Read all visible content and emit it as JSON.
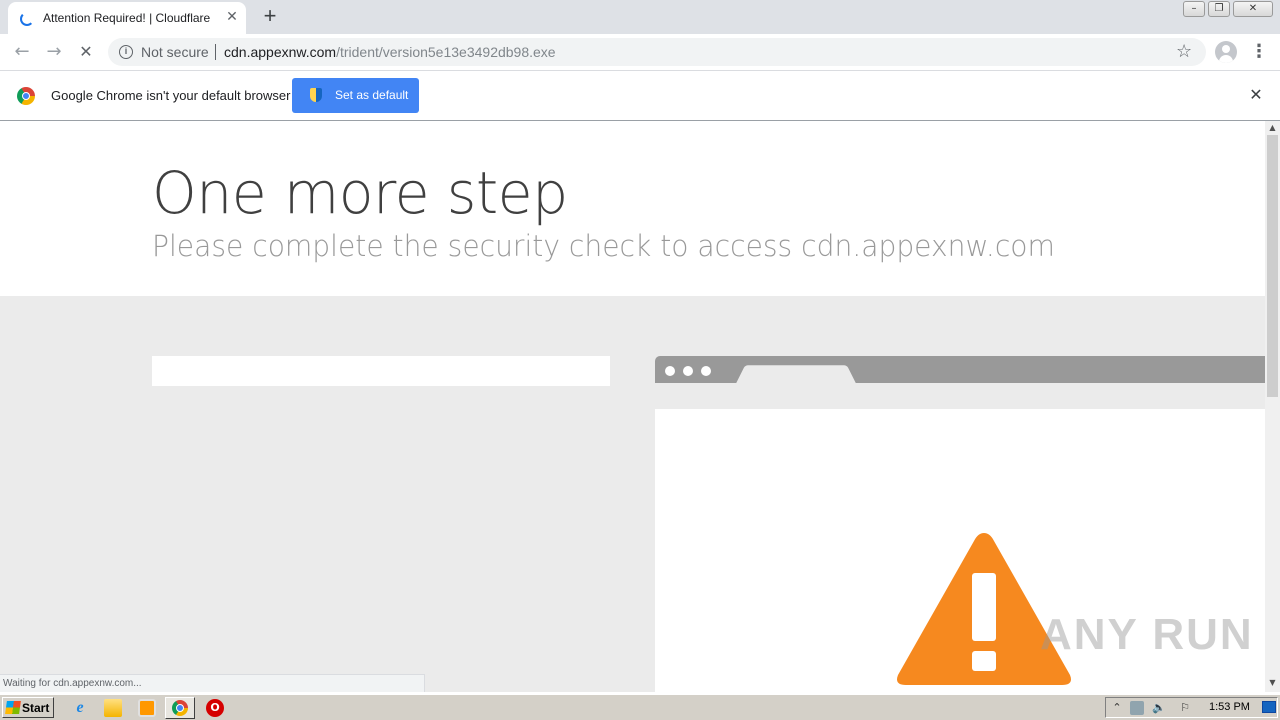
{
  "browser": {
    "tab": {
      "title": "Attention Required! | Cloudflare",
      "close_glyph": "✕"
    },
    "new_tab_glyph": "+",
    "window_controls": {
      "minimize": "–",
      "maximize": "❐",
      "close": "✕"
    },
    "toolbar": {
      "back_glyph": "←",
      "forward_glyph": "→",
      "stop_glyph": "✕",
      "security_label": "Not secure",
      "url_host": "cdn.appexnw.com",
      "url_path": "/trident/version5e13e3492db98.exe",
      "star_glyph": "☆",
      "menu_glyph": "⋮"
    },
    "infobar": {
      "message": "Google Chrome isn't your default browser",
      "button_label": "Set as default",
      "close_glyph": "✕"
    },
    "status_text": "Waiting for cdn.appexnw.com..."
  },
  "page": {
    "headline": "One more step",
    "subline": "Please complete the security check to access cdn.appexnw.com",
    "colors": {
      "warning": "#f6891f",
      "browser_bar": "#999999",
      "background": "#ebebeb"
    }
  },
  "watermark": "ANY RUN",
  "taskbar": {
    "start_label": "Start",
    "ie_glyph": "e",
    "opera_glyph": "O",
    "time": "1:53 PM",
    "tray": {
      "arrow_glyph": "⌃",
      "volume_glyph": "🔈",
      "flag_glyph": "⚐"
    }
  }
}
